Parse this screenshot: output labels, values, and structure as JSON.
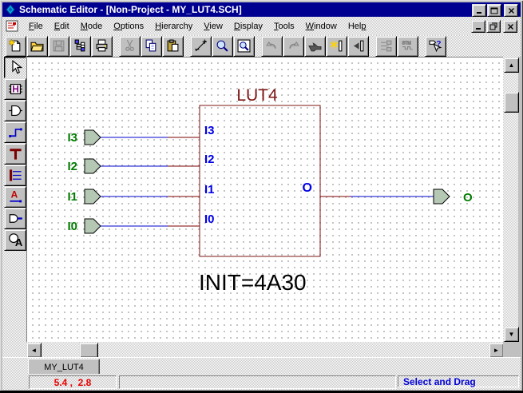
{
  "window": {
    "title": "Schematic Editor - [Non-Project - MY_LUT4.SCH]",
    "controls": [
      "minimize",
      "maximize",
      "close"
    ],
    "mdi_controls": [
      "mdi-minimize",
      "mdi-restore",
      "mdi-close"
    ]
  },
  "menubar": {
    "items": [
      {
        "label": "File",
        "mnemonic": 0
      },
      {
        "label": "Edit",
        "mnemonic": 0
      },
      {
        "label": "Mode",
        "mnemonic": 0
      },
      {
        "label": "Options",
        "mnemonic": 0
      },
      {
        "label": "Hierarchy",
        "mnemonic": 0
      },
      {
        "label": "View",
        "mnemonic": 0
      },
      {
        "label": "Display",
        "mnemonic": 0
      },
      {
        "label": "Tools",
        "mnemonic": 0
      },
      {
        "label": "Window",
        "mnemonic": 0
      },
      {
        "label": "Help",
        "mnemonic": 3
      }
    ]
  },
  "toolbar": {
    "buttons": [
      {
        "name": "new"
      },
      {
        "name": "open"
      },
      {
        "name": "save",
        "disabled": true
      },
      {
        "name": "hierarchy-browser"
      },
      {
        "name": "print"
      },
      {
        "name": "cut",
        "disabled": true,
        "gap": true
      },
      {
        "name": "copy"
      },
      {
        "name": "paste"
      },
      {
        "name": "zoom-in-out",
        "gap": true
      },
      {
        "name": "zoom"
      },
      {
        "name": "zoom-area"
      },
      {
        "name": "undo",
        "disabled": true,
        "gap": true
      },
      {
        "name": "redo",
        "disabled": true
      },
      {
        "name": "pan-hand"
      },
      {
        "name": "add-marker"
      },
      {
        "name": "remove-marker"
      },
      {
        "name": "netlist",
        "disabled": true,
        "gap": true
      },
      {
        "name": "simulation",
        "disabled": true
      },
      {
        "name": "help-select",
        "gap": true
      }
    ]
  },
  "palette": {
    "tools": [
      {
        "name": "select",
        "pressed": true
      },
      {
        "name": "hierarchy-connector"
      },
      {
        "name": "part"
      },
      {
        "name": "wire"
      },
      {
        "name": "bus"
      },
      {
        "name": "bus-tap"
      },
      {
        "name": "net-name"
      },
      {
        "name": "io-terminal"
      },
      {
        "name": "graphics-text"
      }
    ]
  },
  "schematic": {
    "part_name": "LUT4",
    "init_label": "INIT=4A30",
    "inputs": [
      {
        "terminal": "I3",
        "pin": "I3"
      },
      {
        "terminal": "I2",
        "pin": "I2"
      },
      {
        "terminal": "I1",
        "pin": "I1"
      },
      {
        "terminal": "I0",
        "pin": "I0"
      }
    ],
    "output": {
      "terminal": "O",
      "pin": "O"
    }
  },
  "tabs": {
    "items": [
      {
        "label": "MY_LUT4",
        "active": true
      }
    ]
  },
  "statusbar": {
    "coordinates": "5.4 ,  2.8",
    "mode": "Select and Drag"
  },
  "colors": {
    "titlebar": "#000090",
    "wire": "#0000cd",
    "bus_stub": "#7b0000",
    "part_outline": "#7d1414",
    "terminal_label": "#007c00",
    "pin_label": "#0000e8",
    "init_text": "#000000",
    "status_coords": "#e80000",
    "status_mode": "#0000d8"
  }
}
